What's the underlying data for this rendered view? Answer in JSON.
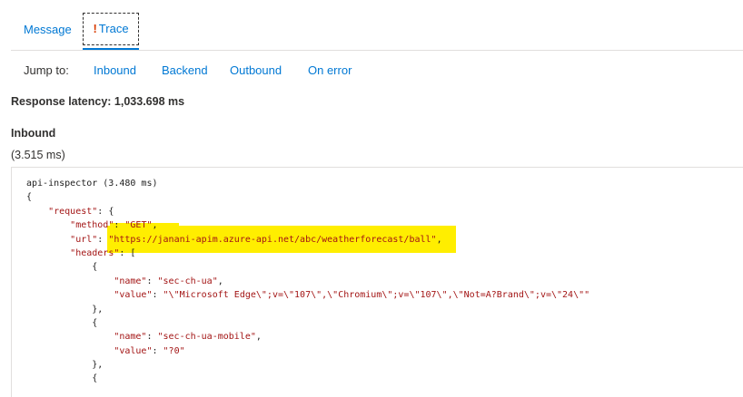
{
  "tabs": {
    "message": "Message",
    "trace_warn": "!",
    "trace": "Trace"
  },
  "jump": {
    "label": "Jump to:",
    "links": [
      "Inbound",
      "Backend",
      "Outbound",
      "On error"
    ]
  },
  "latency": "Response latency: 1,033.698 ms",
  "section": {
    "title": "Inbound",
    "time": "(3.515 ms)"
  },
  "code": {
    "lines": [
      "api-inspector (3.480 ms)",
      "{",
      "    \"request\": {",
      "        \"method\": \"GET\",",
      "        \"url\": \"https://janani-apim.azure-api.net/abc/weatherforecast/ball\",",
      "        \"headers\": [",
      "            {",
      "                \"name\": \"sec-ch-ua\",",
      "                \"value\": \"\\\"Microsoft Edge\\\";v=\\\"107\\\",\\\"Chromium\\\";v=\\\"107\\\",\\\"Not=A?Brand\\\";v=\\\"24\\\"\"",
      "            },",
      "            {",
      "                \"name\": \"sec-ch-ua-mobile\",",
      "                \"value\": \"?0\"",
      "            },",
      "            {"
    ]
  },
  "colors": {
    "accent": "#0078d4",
    "warning": "#d83b01",
    "highlight": "#ffee00",
    "json_key": "#a31515"
  }
}
